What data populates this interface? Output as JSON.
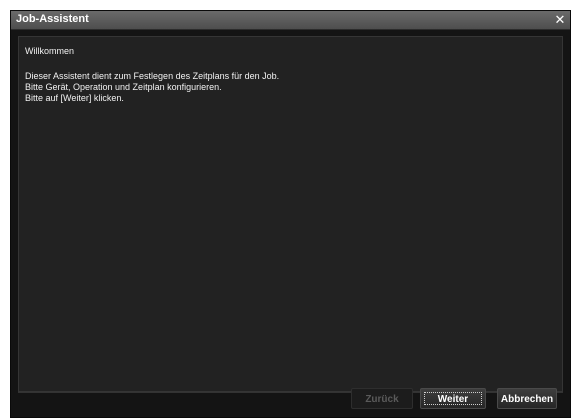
{
  "window": {
    "title": "Job-Assistent",
    "close_icon": "close-icon"
  },
  "content": {
    "welcome": "Willkommen",
    "lines": [
      "Dieser Assistent dient zum Festlegen des Zeitplans für den Job.",
      "Bitte Gerät, Operation und Zeitplan konfigurieren.",
      "Bitte auf [Weiter] klicken."
    ]
  },
  "buttons": {
    "back": "Zurück",
    "next": "Weiter",
    "cancel": "Abbrechen"
  },
  "colors": {
    "background": "#141414",
    "panel": "#222222",
    "titlebar": "#5a5a5a",
    "text": "#f2f2f2"
  }
}
